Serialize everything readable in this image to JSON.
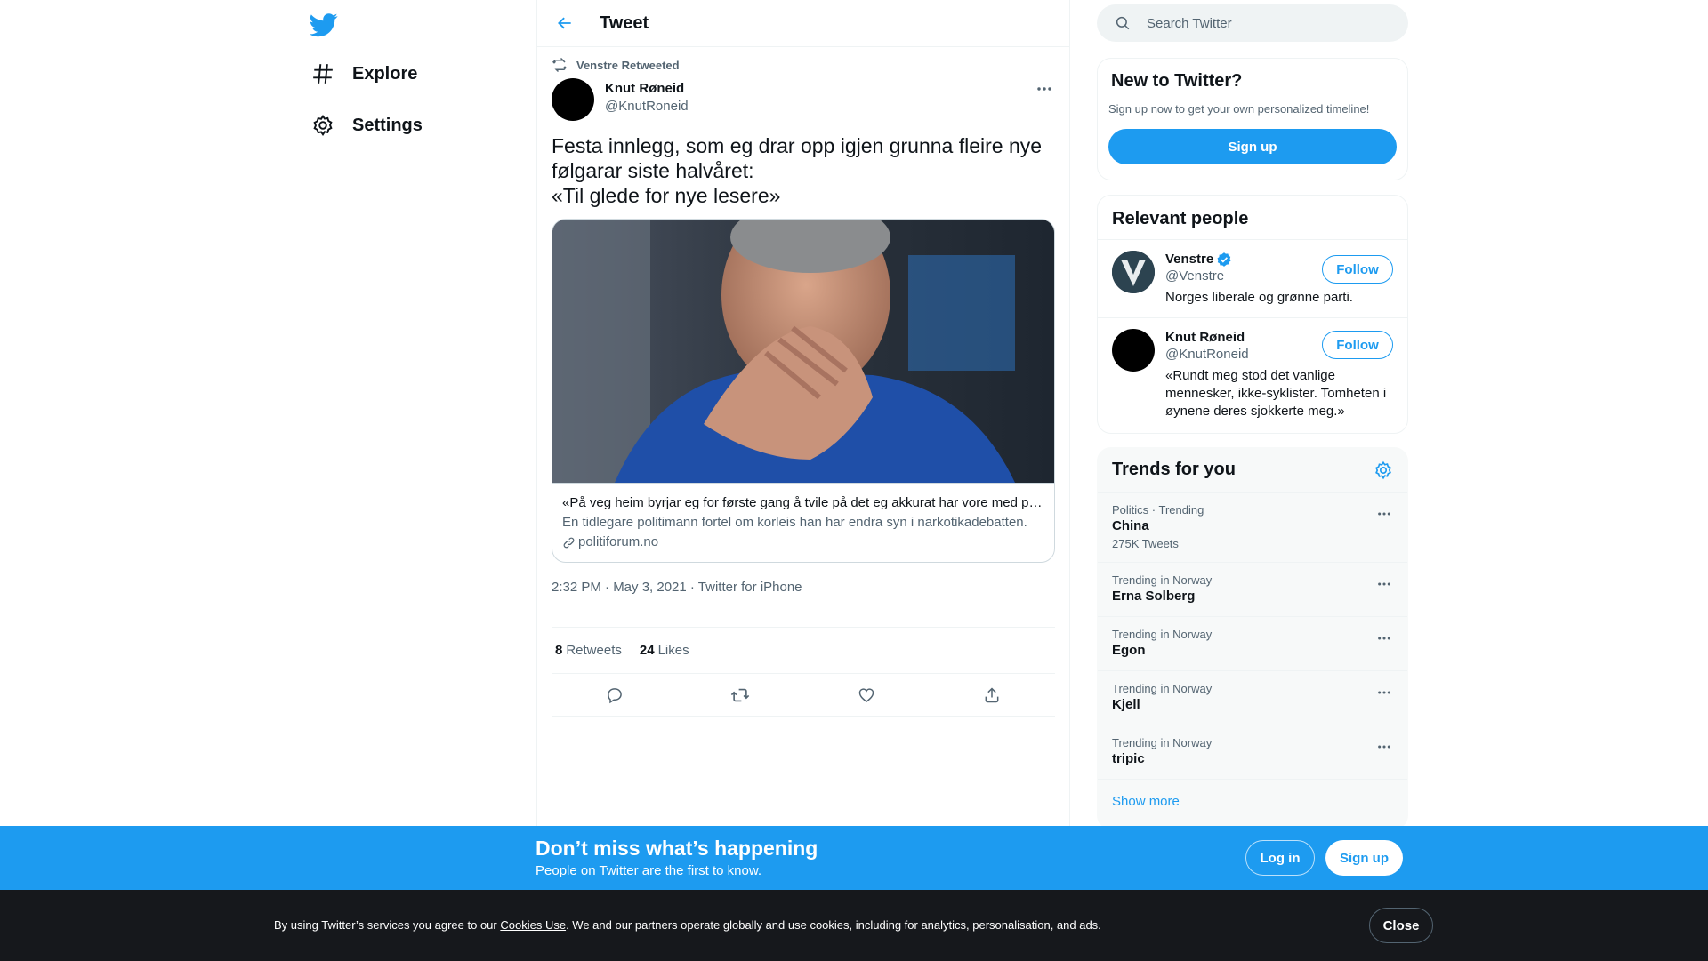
{
  "nav": {
    "logo_icon": "twitter-bird-icon",
    "items": [
      {
        "label": "Explore",
        "icon": "hashtag-icon"
      },
      {
        "label": "Settings",
        "icon": "gear-icon"
      }
    ]
  },
  "header": {
    "title": "Tweet",
    "back_icon": "arrow-left-icon"
  },
  "tweet": {
    "retweeted_by": "Venstre Retweeted",
    "author_name": "Knut Røneid",
    "author_handle": "@KnutRoneid",
    "text": "Festa innlegg, som eg drar opp igjen grunna fleire nye følgarar siste halvåret:\n«Til glede for nye lesere»",
    "card": {
      "title": "«På veg heim byrjar eg for første gang å tvile på det eg akkurat har vore med på. Menneska eg hadde avhøyrt og arrestert var ikkje dei kriminelle eg hadde sett føre meg»",
      "description": "En tidlegare politimann fortel om korleis han har endra syn i narkotikadebatten.",
      "domain": "politiforum.no"
    },
    "timestamp": "2:32 PM · May 3, 2021 · Twitter for iPhone",
    "retweets_count": "8",
    "retweets_label": "Retweets",
    "likes_count": "24",
    "likes_label": "Likes"
  },
  "search": {
    "placeholder": "Search Twitter"
  },
  "new_to_twitter": {
    "title": "New to Twitter?",
    "subtitle": "Sign up now to get your own personalized timeline!",
    "button": "Sign up"
  },
  "relevant_people": {
    "title": "Relevant people",
    "people": [
      {
        "name": "Venstre",
        "handle": "@Venstre",
        "bio": "Norges liberale og grønne parti.",
        "follow": "Follow",
        "verified": true
      },
      {
        "name": "Knut Røneid",
        "handle": "@KnutRoneid",
        "bio": "«Rundt meg stod det vanlige mennesker, ikke-syklister. Tomheten i øynene deres sjokkerte meg.»",
        "follow": "Follow",
        "verified": false
      }
    ]
  },
  "trends": {
    "title": "Trends for you",
    "items": [
      {
        "context": "Politics · Trending",
        "name": "China",
        "count": "275K Tweets"
      },
      {
        "context": "Trending in Norway",
        "name": "Erna Solberg"
      },
      {
        "context": "Trending in Norway",
        "name": "Egon"
      },
      {
        "context": "Trending in Norway",
        "name": "Kjell"
      },
      {
        "context": "Trending in Norway",
        "name": "tripic"
      }
    ],
    "show_more": "Show more"
  },
  "banner": {
    "title": "Don’t miss what’s happening",
    "subtitle": "People on Twitter are the first to know.",
    "login": "Log in",
    "signup": "Sign up"
  },
  "cookie": {
    "text_before": "By using Twitter’s services you agree to our ",
    "link": "Cookies Use",
    "text_after": ". We and our partners operate globally and use cookies, including for analytics, personalisation, and ads.",
    "close": "Close"
  },
  "colors": {
    "accent": "#1d9bf0",
    "text": "#0f1419",
    "secondary": "#536471",
    "cookie_bg": "#16181c"
  }
}
